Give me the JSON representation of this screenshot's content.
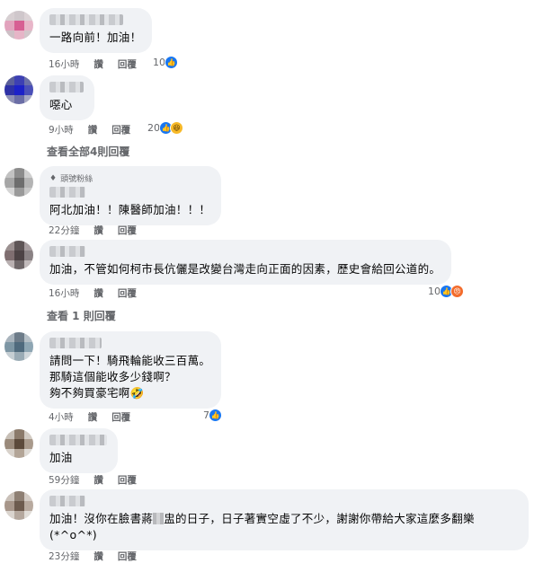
{
  "comments": [
    {
      "text": "一路向前！加油！",
      "time": "16小時",
      "like": "讚",
      "reply": "回覆",
      "reaction_count": "10",
      "reactions": [
        "like"
      ]
    },
    {
      "text": "噁心",
      "time": "9小時",
      "like": "讚",
      "reply": "回覆",
      "reaction_count": "20",
      "reactions": [
        "like",
        "haha"
      ]
    },
    {
      "badge": "頭號粉絲",
      "text": "阿北加油！！陳醫師加油！！！",
      "time": "22分鐘",
      "like": "讚",
      "reply": "回覆"
    },
    {
      "text": "加油，不管如何柯市長伉儷是改變台灣走向正面的因素，歷史會給回公道的。",
      "time": "16小時",
      "like": "讚",
      "reply": "回覆",
      "reaction_count": "10",
      "reactions": [
        "like",
        "angry"
      ]
    },
    {
      "text": "請問一下！騎飛輪能收三百萬。\n那騎這個能收多少錢啊？\n夠不夠買豪宅啊🤣",
      "time": "4小時",
      "like": "讚",
      "reply": "回覆",
      "reaction_count": "7",
      "reactions": [
        "like"
      ]
    },
    {
      "text": "加油",
      "time": "59分鐘",
      "like": "讚",
      "reply": "回覆"
    },
    {
      "text_before": "加油！沒你在臉書蔣",
      "text_after": "盅的日子，日子著實空虛了不少，謝謝你帶給大家這麼多翻樂\n(*^o^*)",
      "time": "23分鐘",
      "like": "讚",
      "reply": "回覆"
    }
  ],
  "view_replies": [
    {
      "label": "查看全部4則回覆"
    },
    {
      "label": "查看 1 則回覆"
    }
  ],
  "icons": {
    "like": "like-icon",
    "haha": "haha-icon",
    "angry": "angry-icon",
    "badge": "diamond-icon"
  },
  "colors": {
    "bubble": "#f0f2f5",
    "meta": "#65676b",
    "like": "#1877f2",
    "haha": "#f7b928",
    "angry": "#f36c2c"
  }
}
